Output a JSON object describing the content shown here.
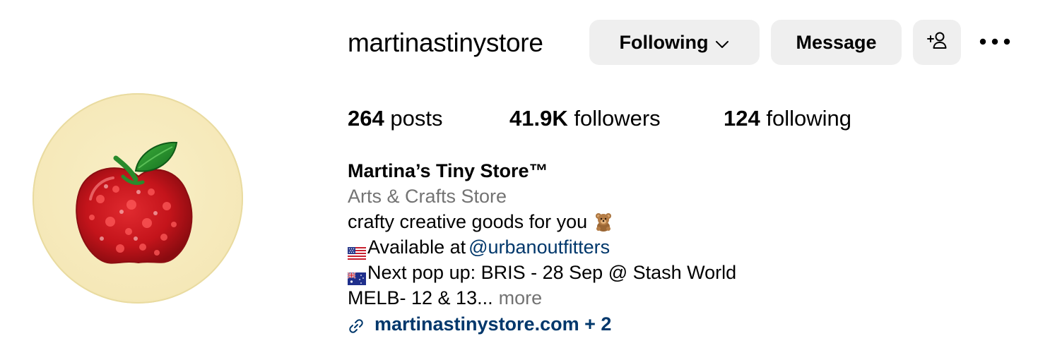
{
  "profile": {
    "username": "martinastinystore",
    "display_name": "Martina’s Tiny Store™",
    "category": "Arts & Crafts Store",
    "avatar": "red-glitter-apple-avatar"
  },
  "actions": {
    "following_label": "Following",
    "message_label": "Message",
    "add_user_icon": "add-person-icon",
    "more_icon": "ellipsis-icon"
  },
  "stats": {
    "posts_count": "264",
    "posts_label": "posts",
    "followers_count": "41.9K",
    "followers_label": "followers",
    "following_count": "124",
    "following_label": "following"
  },
  "bio": {
    "line1": "crafty creative goods for you",
    "line1_emoji": "teddy-bear-emoji",
    "line2_prefix": "Available at",
    "line2_flag": "us-flag-emoji",
    "line2_mention": "@urbanoutfitters",
    "line3": "Next pop up: BRIS - 28 Sep @ Stash World",
    "line3_flag": "australia-flag-emoji",
    "line4": "MELB- 12 & 13...",
    "more_label": "more"
  },
  "link": {
    "text": "martinastinystore.com + 2",
    "icon": "link-icon"
  },
  "colors": {
    "button_bg": "#efefef",
    "link_blue": "#00376b",
    "secondary_gray": "#737373",
    "avatar_bg": "#f6eabd",
    "apple_red": "#c8141c",
    "leaf_green": "#1f8a2a"
  }
}
